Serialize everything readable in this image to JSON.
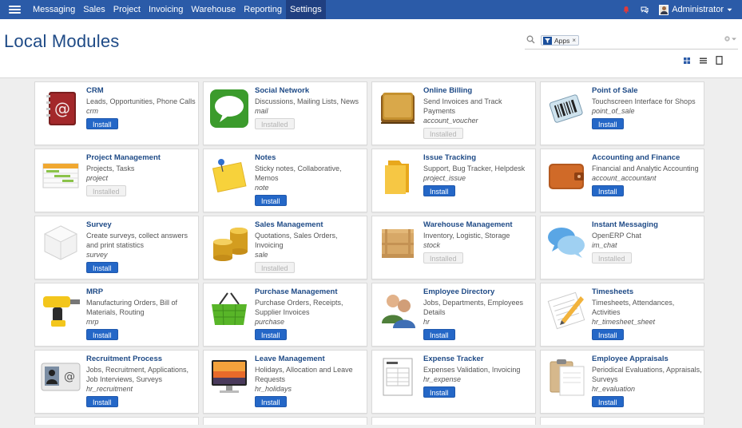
{
  "navbar": {
    "menu": [
      {
        "label": "Messaging",
        "active": false
      },
      {
        "label": "Sales",
        "active": false
      },
      {
        "label": "Project",
        "active": false
      },
      {
        "label": "Invoicing",
        "active": false
      },
      {
        "label": "Warehouse",
        "active": false
      },
      {
        "label": "Reporting",
        "active": false
      },
      {
        "label": "Settings",
        "active": true
      }
    ],
    "user_name": "Administrator",
    "icons": [
      "menu-icon",
      "bell-icon",
      "chat-icon",
      "chevron-down-icon"
    ]
  },
  "control_panel": {
    "title": "Local Modules",
    "search": {
      "facet_label": "Apps",
      "facet_icon": "filter-icon",
      "close_glyph": "×"
    },
    "views": [
      "kanban-view-icon",
      "list-view-icon",
      "form-view-icon"
    ]
  },
  "colors": {
    "navbar": "#2b5ba8",
    "accent": "#2467c7",
    "title": "#1e4a86"
  },
  "modules": [
    {
      "name": "CRM",
      "summary": "Leads, Opportunities, Phone Calls",
      "tech": "crm",
      "button": "Install",
      "installed": false,
      "icon": "address-book-icon"
    },
    {
      "name": "Social Network",
      "summary": "Discussions, Mailing Lists, News",
      "tech": "mail",
      "button": "Installed",
      "installed": true,
      "icon": "speech-bubble-icon"
    },
    {
      "name": "Online Billing",
      "summary": "Send Invoices and Track Payments",
      "tech": "account_voucher",
      "button": "Installed",
      "installed": true,
      "icon": "wallet-icon"
    },
    {
      "name": "Point of Sale",
      "summary": "Touchscreen Interface for Shops",
      "tech": "point_of_sale",
      "button": "Install",
      "installed": false,
      "icon": "barcode-scanner-icon"
    },
    {
      "name": "Project Management",
      "summary": "Projects, Tasks",
      "tech": "project",
      "button": "Installed",
      "installed": true,
      "icon": "gantt-chart-icon"
    },
    {
      "name": "Notes",
      "summary": "Sticky notes, Collaborative, Memos",
      "tech": "note",
      "button": "Install",
      "installed": false,
      "icon": "sticky-note-icon"
    },
    {
      "name": "Issue Tracking",
      "summary": "Support, Bug Tracker, Helpdesk",
      "tech": "project_issue",
      "button": "Install",
      "installed": false,
      "icon": "folder-icon"
    },
    {
      "name": "Accounting and Finance",
      "summary": "Financial and Analytic Accounting",
      "tech": "account_accountant",
      "button": "Install",
      "installed": false,
      "icon": "leather-wallet-icon"
    },
    {
      "name": "Survey",
      "summary": "Create surveys, collect answers and print statistics",
      "tech": "survey",
      "button": "Install",
      "installed": false,
      "icon": "cube-icon"
    },
    {
      "name": "Sales Management",
      "summary": "Quotations, Sales Orders, Invoicing",
      "tech": "sale",
      "button": "Installed",
      "installed": true,
      "icon": "coins-icon"
    },
    {
      "name": "Warehouse Management",
      "summary": "Inventory, Logistic, Storage",
      "tech": "stock",
      "button": "Installed",
      "installed": true,
      "icon": "crate-icon"
    },
    {
      "name": "Instant Messaging",
      "summary": "OpenERP Chat",
      "tech": "im_chat",
      "button": "Installed",
      "installed": true,
      "icon": "chat-bubbles-icon"
    },
    {
      "name": "MRP",
      "summary": "Manufacturing Orders, Bill of Materials, Routing",
      "tech": "mrp",
      "button": "Install",
      "installed": false,
      "icon": "drill-icon"
    },
    {
      "name": "Purchase Management",
      "summary": "Purchase Orders, Receipts, Supplier Invoices",
      "tech": "purchase",
      "button": "Install",
      "installed": false,
      "icon": "shopping-basket-icon"
    },
    {
      "name": "Employee Directory",
      "summary": "Jobs, Departments, Employees Details",
      "tech": "hr",
      "button": "Install",
      "installed": false,
      "icon": "people-icon"
    },
    {
      "name": "Timesheets",
      "summary": "Timesheets, Attendances, Activities",
      "tech": "hr_timesheet_sheet",
      "button": "Install",
      "installed": false,
      "icon": "pencil-sheet-icon"
    },
    {
      "name": "Recruitment Process",
      "summary": "Jobs, Recruitment, Applications, Job Interviews, Surveys",
      "tech": "hr_recruitment",
      "button": "Install",
      "installed": false,
      "icon": "id-card-icon"
    },
    {
      "name": "Leave Management",
      "summary": "Holidays, Allocation and Leave Requests",
      "tech": "hr_holidays",
      "button": "Install",
      "installed": false,
      "icon": "sunset-monitor-icon"
    },
    {
      "name": "Expense Tracker",
      "summary": "Expenses Validation, Invoicing",
      "tech": "hr_expense",
      "button": "Install",
      "installed": false,
      "icon": "invoice-icon"
    },
    {
      "name": "Employee Appraisals",
      "summary": "Periodical Evaluations, Appraisals, Surveys",
      "tech": "hr_evaluation",
      "button": "Install",
      "installed": false,
      "icon": "clipboard-icon"
    }
  ]
}
